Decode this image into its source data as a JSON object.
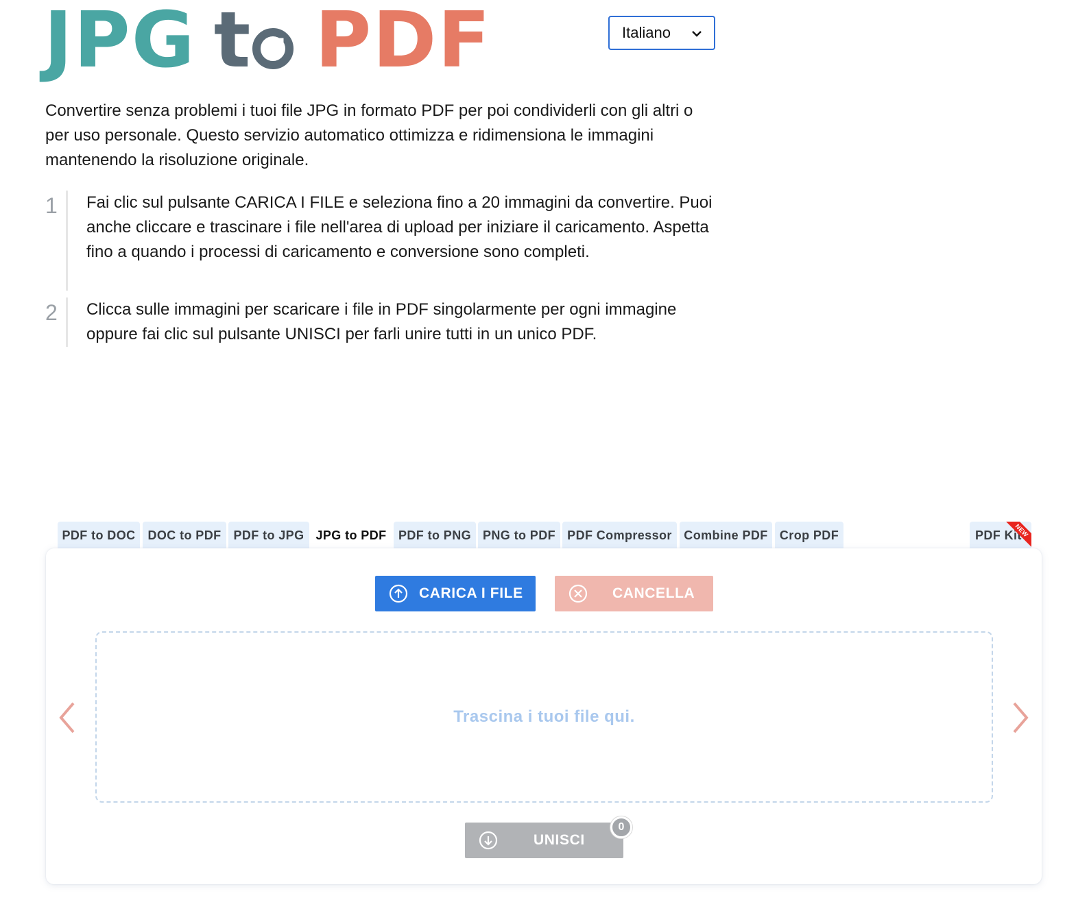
{
  "logo": {
    "part1": "JPG",
    "part2": "t",
    "part3": "PDF",
    "colors": {
      "jpg": "#4aa6a3",
      "to": "#5b6b77",
      "pdf": "#e67b65"
    }
  },
  "language": {
    "selected": "Italiano",
    "icon": "chevron-down-icon"
  },
  "intro": "Convertire senza problemi i tuoi file JPG in formato PDF per poi condividerli con gli altri o per uso personale. Questo servizio automatico ottimizza e ridimensiona le immagini mantenendo la risoluzione originale.",
  "steps": [
    {
      "number": "1",
      "text": "Fai clic sul pulsante CARICA I FILE e seleziona fino a 20 immagini da convertire. Puoi anche cliccare e trascinare i file nell'area di upload per iniziare il caricamento. Aspetta fino a quando i processi di caricamento e conversione sono completi."
    },
    {
      "number": "2",
      "text": "Clicca sulle immagini per scaricare i file in PDF singolarmente per ogni immagine oppure fai clic sul pulsante UNISCI per farli unire tutti in un unico PDF."
    }
  ],
  "tabs": [
    {
      "label": "PDF to DOC"
    },
    {
      "label": "DOC to PDF"
    },
    {
      "label": "PDF to JPG"
    },
    {
      "label": "JPG to PDF",
      "active": true
    },
    {
      "label": "PDF to PNG"
    },
    {
      "label": "PNG to PDF"
    },
    {
      "label": "PDF Compressor"
    },
    {
      "label": "Combine PDF"
    },
    {
      "label": "Crop PDF"
    },
    {
      "label": "PDF Kit",
      "ribbon": "NEW"
    }
  ],
  "actions": {
    "upload_label": "CARICA I FILE",
    "upload_icon": "upload-circle-icon",
    "cancel_label": "CANCELLA",
    "cancel_icon": "close-circle-icon",
    "merge_label": "UNISCI",
    "merge_icon": "download-circle-icon",
    "merge_count": "0"
  },
  "dropzone": {
    "hint": "Trascina i tuoi file qui."
  },
  "colors": {
    "primary": "#2f7be0",
    "cancel": "#f0b7ae",
    "merge": "#b1b3b6",
    "tab_bg": "#e6f0fb",
    "arrow": "#e8a39a",
    "ribbon": "#e8251f"
  }
}
